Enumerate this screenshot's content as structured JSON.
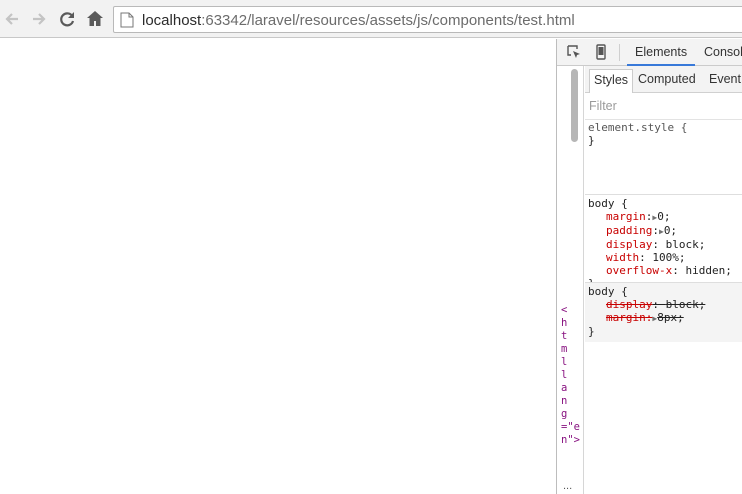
{
  "browser": {
    "url_host": "localhost",
    "url_rest": ":63342/laravel/resources/assets/js/components/test.html",
    "nav_icons": [
      "back-arrow-icon",
      "forward-arrow-icon",
      "reload-icon",
      "home-icon"
    ]
  },
  "devtools": {
    "tabs": [
      "Elements",
      "Console"
    ],
    "active_tab": "Elements",
    "dom_fragment": "<html lang=\"en\">",
    "dom_more": "...",
    "subtabs": [
      "Styles",
      "Computed",
      "Event"
    ],
    "filter_placeholder": "Filter",
    "rules": [
      {
        "selector": "element.style {",
        "declarations": [],
        "close": "}"
      },
      {
        "selector": "body {",
        "declarations": [
          {
            "prop": "margin",
            "sep": ":",
            "expand": "▶",
            "value": "0;"
          },
          {
            "prop": "padding",
            "sep": ":",
            "expand": "▶",
            "value": "0;"
          },
          {
            "prop": "display",
            "sep": ": ",
            "expand": "",
            "value": "block;"
          },
          {
            "prop": "width",
            "sep": ": ",
            "expand": "",
            "value": "100%;"
          },
          {
            "prop": "overflow-x",
            "sep": ": ",
            "expand": "",
            "value": "hidden;"
          }
        ],
        "close": "}"
      },
      {
        "selector": "body {",
        "declarations": [
          {
            "prop": "display",
            "sep": ": ",
            "expand": "",
            "value": "block;"
          },
          {
            "prop": "margin",
            "sep": ":",
            "expand": "▶",
            "value": "8px;"
          }
        ],
        "close": "}"
      }
    ]
  },
  "colors": {
    "property": "#c80000",
    "tab_accent": "#3879d9",
    "dom_tag": "#881280"
  }
}
